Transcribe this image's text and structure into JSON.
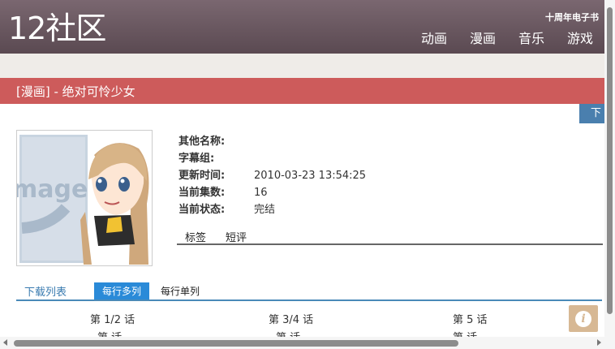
{
  "site": {
    "logo": "12社区",
    "anniversary": "十周年电子书"
  },
  "nav": [
    "动画",
    "漫画",
    "音乐",
    "游戏"
  ],
  "page_title": "[漫画] - 绝对可怜少女",
  "download_button": "下",
  "info": [
    {
      "label": "其他名称:",
      "value": ""
    },
    {
      "label": "字幕组:",
      "value": ""
    },
    {
      "label": "更新时间:",
      "value": "2010-03-23 13:54:25"
    },
    {
      "label": "当前集数:",
      "value": "16"
    },
    {
      "label": "当前状态:",
      "value": "完结"
    }
  ],
  "tabs": [
    "标签",
    "短评"
  ],
  "download": {
    "title": "下载列表",
    "mode_selected": "每行多列",
    "mode_other": "每行单列",
    "episodes": [
      "第 1/2 话",
      "第 3/4 话",
      "第 5 话"
    ],
    "episodes_next": [
      "第 话",
      "第 话",
      "第 话"
    ]
  },
  "placeholder_text": "mage",
  "colors": {
    "header": "#6b5860",
    "title_bar": "#cd5b5b",
    "accent": "#2a8ad8"
  }
}
